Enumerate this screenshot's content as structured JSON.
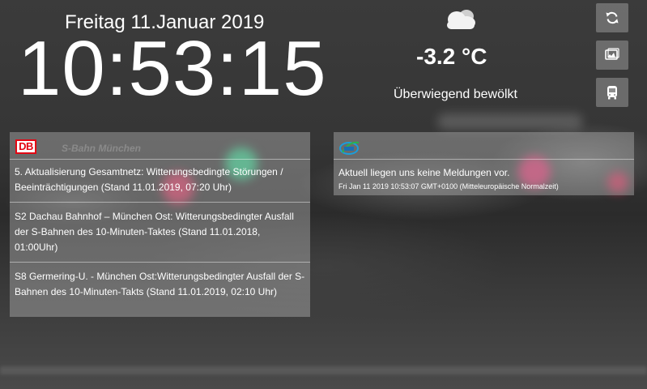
{
  "header": {
    "date": "Freitag 11.Januar 2019",
    "time": "10:53:15"
  },
  "weather": {
    "icon": "cloud-icon",
    "temperature": "-3.2 °C",
    "condition": "Überwiegend bewölkt"
  },
  "buttons": [
    {
      "icon": "refresh-icon"
    },
    {
      "icon": "image-icon"
    },
    {
      "icon": "bus-icon"
    }
  ],
  "sbahn": {
    "logo": "DB",
    "title": "S-Bahn München",
    "items": [
      {
        "text": "5. Aktualisierung Gesamtnetz: Witterungsbedingte Störungen / Beeinträchtigungen (Stand 11.01.2019, 07:20 Uhr)"
      },
      {
        "text": "S2 Dachau Bahnhof – München Ost: Witterungsbedingter Ausfall der S-Bahnen des 10-Minuten-Taktes (Stand 11.01.2018, 01:00Uhr)"
      },
      {
        "text": "S8 Germering-U. - München Ost:Witterungsbedingter Ausfall der S-Bahnen des 10-Minuten-Takts (Stand 11.01.2019, 02:10 Uhr)"
      }
    ]
  },
  "mvv": {
    "logo": "mvv-logo-icon",
    "message": "Aktuell liegen uns keine Meldungen vor.",
    "timestamp": "Fri Jan 11 2019 10:53:07 GMT+0100 (Mitteleuropäische Normalzeit)"
  },
  "colors": {
    "db_red": "#e30613",
    "panel_bg": "rgba(190,190,190,0.40)",
    "button_bg": "rgba(170,170,170,0.45)"
  }
}
